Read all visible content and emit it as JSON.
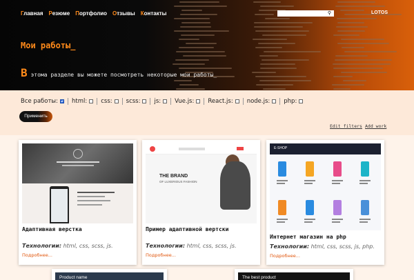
{
  "nav": {
    "items": [
      "Главная",
      "Резюме",
      "Портфолио",
      "Отзывы",
      "Контакты"
    ],
    "brand": "LOTOS"
  },
  "search": {
    "placeholder": "",
    "icon": "search-icon"
  },
  "hero": {
    "title": "Мои работы_",
    "subtitle_first": "В",
    "subtitle_rest": " этома разделе вы можете посмотреть некоторые мои работы_"
  },
  "filters": [
    {
      "label": "Все работы:",
      "checked": true
    },
    {
      "label": "html:",
      "checked": false
    },
    {
      "label": "css:",
      "checked": false
    },
    {
      "label": "scss:",
      "checked": false
    },
    {
      "label": "js:",
      "checked": false
    },
    {
      "label": "Vue.js:",
      "checked": false
    },
    {
      "label": "React.js:",
      "checked": false
    },
    {
      "label": "node.js:",
      "checked": false
    },
    {
      "label": "php:",
      "checked": false
    }
  ],
  "actions": {
    "apply": "Применить",
    "edit_filters": "Edit filters",
    "add_work": "Add work"
  },
  "cards": [
    {
      "title": "Адаптивная верстка",
      "tech_label": "Технологии:",
      "tech": "html, css, scss, js.",
      "more": "Подробнее..."
    },
    {
      "title": "Пример адаптивной вертски",
      "tech_label": "Технологии:",
      "tech": "html, css, scss, js.",
      "more": "Подробнее...",
      "thumb_brand": "THE BRAND",
      "thumb_brand_sub": "OF LUXERIOUS FASHION"
    },
    {
      "title": "Интернет магазин на php",
      "tech_label": "Технологии:",
      "tech": "html, css, scss, js, php.",
      "more": "Подробнее...",
      "thumb_label": "E-SHOP"
    }
  ],
  "bottom_cards": [
    {
      "thumb_text": "Product name"
    },
    {
      "thumb_text": "The best product"
    }
  ],
  "colors": {
    "accent": "#ff8a1a",
    "link": "#e0540a",
    "page_bg": "#fde9d9",
    "checkbox_checked": "#2b68d9"
  }
}
